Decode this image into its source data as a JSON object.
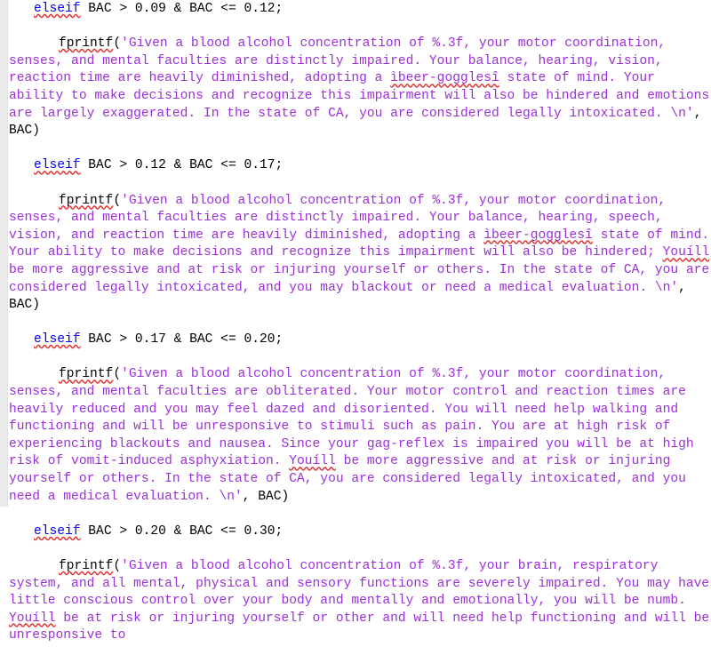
{
  "app": {
    "kind": "matlab-code-editor",
    "language": "MATLAB"
  },
  "theme": {
    "background": "#ffffff",
    "gutter_background": "#ebebeb",
    "keyword_color": "#0000ff",
    "string_color": "#9b30d9",
    "plain_color": "#000000",
    "spellcheck_underline_color": "#e03030"
  },
  "code": {
    "blocks": [
      {
        "condition_keyword": "elseif",
        "condition_expr": " BAC > 0.09 & BAC <= 0.12;",
        "call_name": "fprintf",
        "call_open": "(",
        "string": "'Given a blood alcohol concentration of %.3f, your motor coordination, senses, and mental faculties are distinctly impaired. Your balance, hearing, vision, reaction time are heavily diminished, adopting a ìbeer-gogglesî state of mind. Your ability to make decisions and recognize this impairment will also be hindered and emotions are largely exaggerated. In the state of CA, you are considered legally intoxicated. \\n'",
        "call_tail": ", BAC)",
        "misspelled": [
          "ìbeer-gogglesî"
        ]
      },
      {
        "condition_keyword": "elseif",
        "condition_expr": " BAC > 0.12 & BAC <= 0.17;",
        "call_name": "fprintf",
        "call_open": "(",
        "string": "'Given a blood alcohol concentration of %.3f, your motor coordination, senses, and mental faculties are distinctly impaired. Your balance, hearing, speech, vision, and reaction time are heavily diminished, adopting a ìbeer-gogglesî state of mind. Your ability to make decisions and recognize this impairment will also be hindered; Youíll be more aggressive and at risk or injuring yourself or others. In the state of CA, you are considered legally intoxicated, and you may blackout or need a medical evaluation. \\n'",
        "call_tail": ", BAC)",
        "misspelled": [
          "ìbeer-gogglesî",
          "Youíll"
        ]
      },
      {
        "condition_keyword": "elseif",
        "condition_expr": " BAC > 0.17 & BAC <= 0.20;",
        "call_name": "fprintf",
        "call_open": "(",
        "string": "'Given a blood alcohol concentration of %.3f, your motor coordination, senses, and mental faculties are obliterated. Your motor control and reaction times are heavily reduced and you may feel dazed and disoriented. You will need help walking and functioning and will be unresponsive to stimuli such as pain. You are at high risk of experiencing blackouts and nausea. Since your gag-reflex is impaired you will be at high risk of vomit-induced asphyxiation. Youíll be more aggressive and at risk or injuring yourself or others. In the state of CA, you are considered legally intoxicated, and you need a medical evaluation. \\n'",
        "call_tail": ", BAC)",
        "misspelled": [
          "Youíll"
        ]
      },
      {
        "condition_keyword": "elseif",
        "condition_expr": " BAC > 0.20 & BAC <= 0.30;",
        "call_name": "fprintf",
        "call_open": "(",
        "string": "'Given a blood alcohol concentration of %.3f, your brain, respiratory system, and all mental, physical and sensory functions are severely impaired. You may have little conscious control over your body and mentally and emotionally, you will be numb. Youíll be at risk or injuring yourself or other and will need help functioning and will be unresponsive to",
        "call_tail": "",
        "misspelled": [
          "Youíll"
        ]
      }
    ]
  }
}
